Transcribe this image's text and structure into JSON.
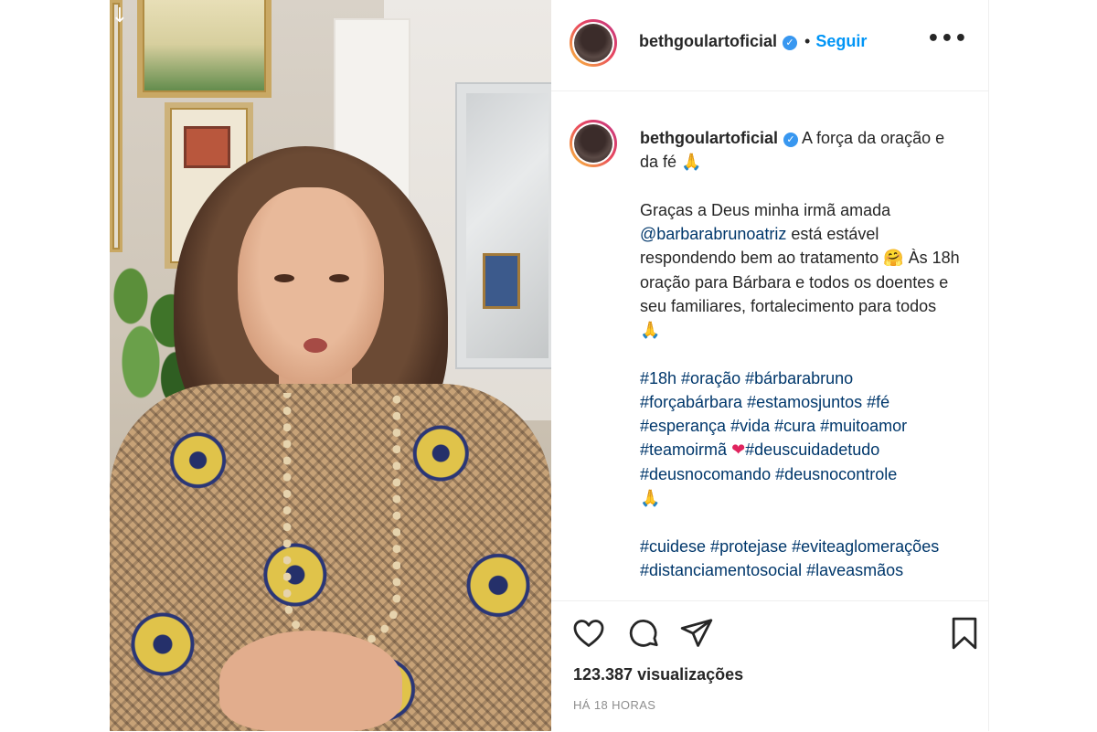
{
  "post": {
    "username": "bethgoulartoficial",
    "verified_badge": "✓",
    "follow_label": "Seguir",
    "separator": "•",
    "more_icon": "•••",
    "download_icon": "↓"
  },
  "caption": {
    "line_title": "A força da oração e da fé",
    "emoji_pray": "🙏",
    "emoji_hug": "🤗",
    "text_1": "Graças a Deus minha irmã amada",
    "mention": "@barbarabrunoatriz",
    "text_2": "está estável respondendo bem ao tratamento",
    "text_3": "Às 18h oração para Bárbara e todos os doentes e seu familiares, fortalecimento para todos",
    "hashtags_1": "#18h #oração #bárbarabruno #forçabárbara #estamosjuntos #fé #esperança #vida #cura #muitoamor #teamoirmã",
    "heart_emoji": "❤",
    "hashtags_2": "#deuscuidadetudo #deusnocomando #deusnocontrole",
    "hashtags_3": "#cuidese #protejase #eviteaglomerações #distanciamentosocial #laveasmãos"
  },
  "actions": {
    "icons": [
      "heart-icon",
      "comment-icon",
      "share-icon",
      "bookmark-icon"
    ],
    "views": "123.387 visualizações",
    "timestamp": "HÁ 18 HORAS"
  }
}
